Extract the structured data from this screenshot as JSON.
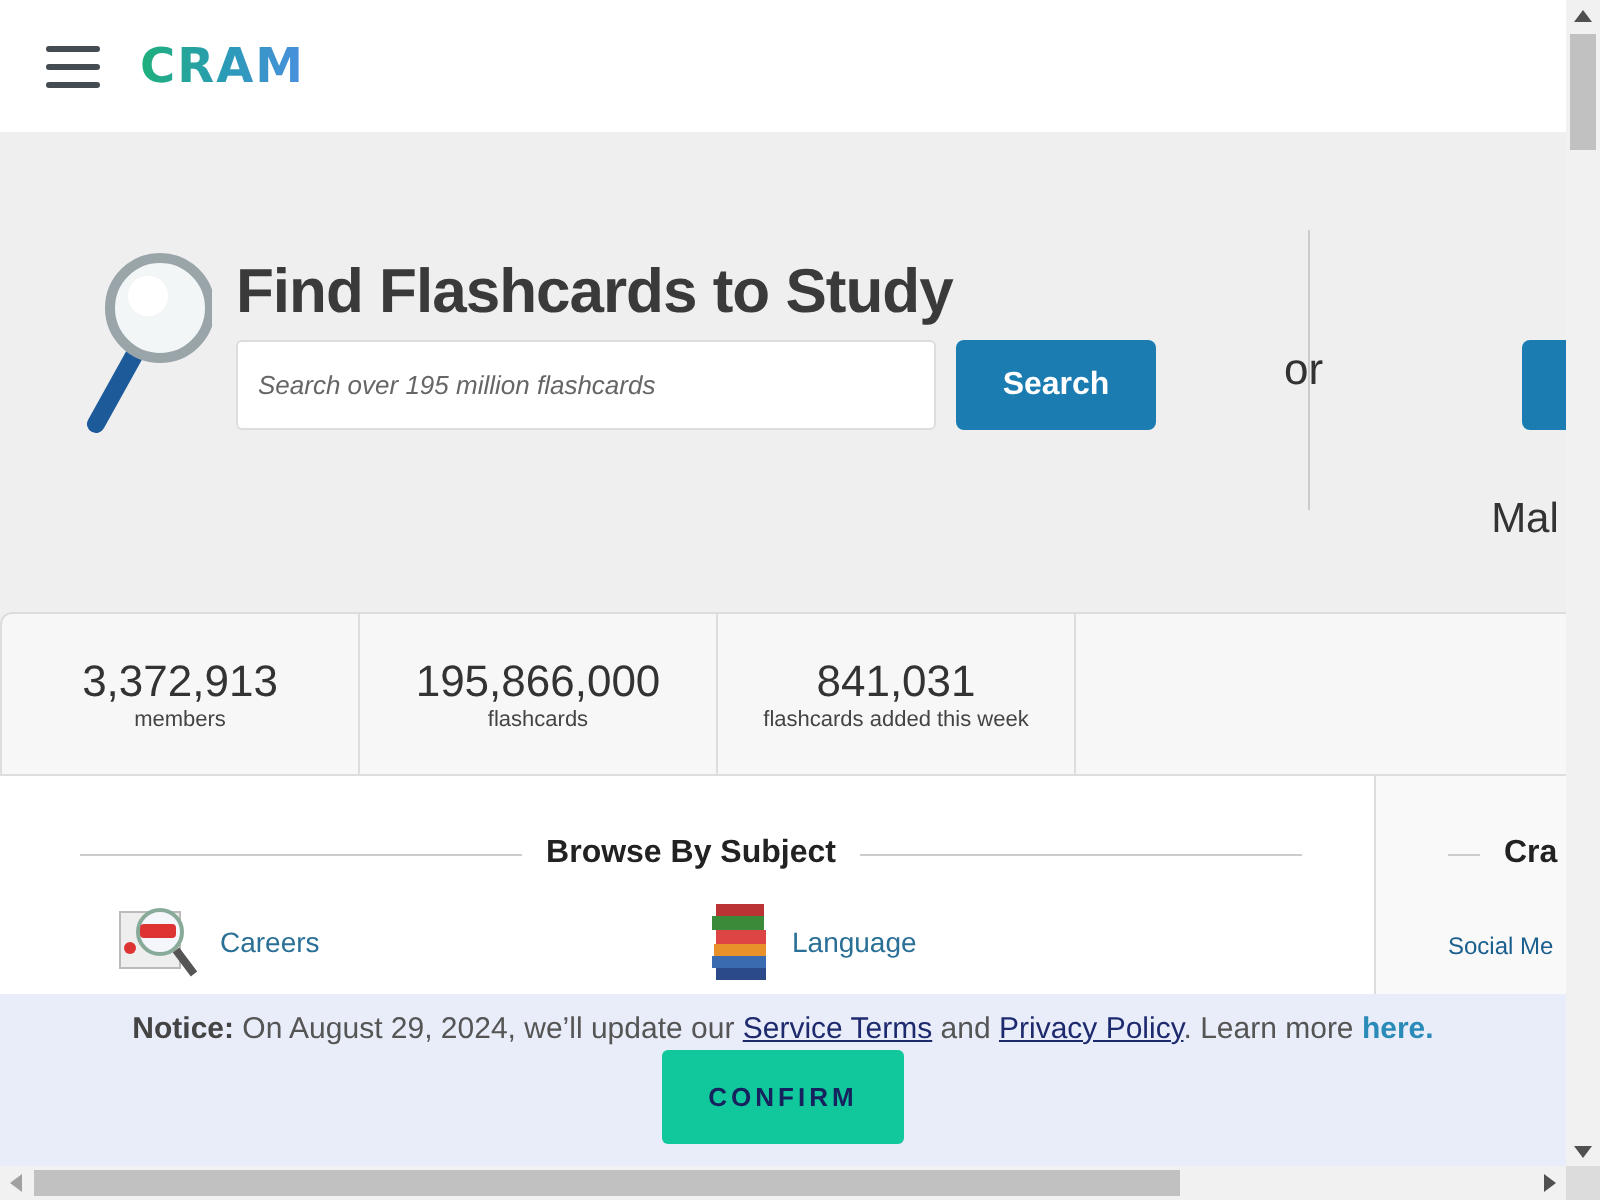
{
  "header": {
    "logo": "CRAM"
  },
  "hero": {
    "title": "Find Flashcards to Study",
    "search": {
      "placeholder": "Search over 195 million flashcards"
    },
    "search_button": "Search",
    "or": "or",
    "right_caption": "Mal"
  },
  "stats": [
    {
      "value": "3,372,913",
      "label": "members"
    },
    {
      "value": "195,866,000",
      "label": "flashcards"
    },
    {
      "value": "841,031",
      "label": "flashcards added this week"
    }
  ],
  "browse": {
    "title": "Browse By Subject",
    "subjects": [
      {
        "kind": "careers",
        "label": "Careers"
      },
      {
        "kind": "language",
        "label": "Language"
      }
    ]
  },
  "side": {
    "title": "Cra",
    "link": "Social Me"
  },
  "notice": {
    "segments": [
      {
        "kind": "text",
        "text": "**Notice:** On August 29, 2024, we’ll update our "
      },
      {
        "kind": "link",
        "text": "Service Terms"
      },
      {
        "kind": "text",
        "text": " and "
      },
      {
        "kind": "link",
        "text": "Privacy Policy"
      },
      {
        "kind": "text",
        "text": ". Learn more "
      },
      {
        "kind": "strong_link",
        "text": "here."
      }
    ],
    "button": "CONFIRM"
  }
}
